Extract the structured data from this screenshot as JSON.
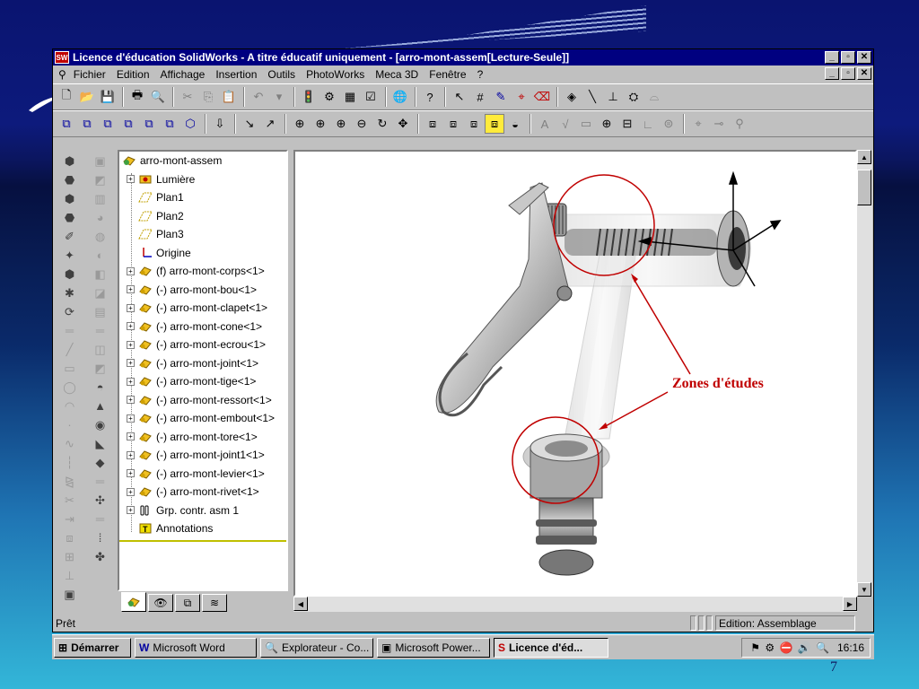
{
  "window": {
    "title": "Licence d'éducation SolidWorks - A titre éducatif uniquement - [arro-mont-assem[Lecture-Seule]]",
    "app_badge": "SW"
  },
  "menu": {
    "items": [
      {
        "label": "Fichier"
      },
      {
        "label": "Edition"
      },
      {
        "label": "Affichage"
      },
      {
        "label": "Insertion"
      },
      {
        "label": "Outils"
      },
      {
        "label": "PhotoWorks"
      },
      {
        "label": "Meca 3D"
      },
      {
        "label": "Fenêtre"
      },
      {
        "label": "?"
      }
    ]
  },
  "tree": {
    "root": "arro-mont-assem",
    "items": [
      {
        "label": "Lumière",
        "icon": "light-icon",
        "expandable": true
      },
      {
        "label": "Plan1",
        "icon": "plane-icon",
        "expandable": false
      },
      {
        "label": "Plan2",
        "icon": "plane-icon",
        "expandable": false
      },
      {
        "label": "Plan3",
        "icon": "plane-icon",
        "expandable": false
      },
      {
        "label": "Origine",
        "icon": "origin-icon",
        "expandable": false
      },
      {
        "label": "(f) arro-mont-corps<1>",
        "icon": "part-icon",
        "expandable": true
      },
      {
        "label": "(-) arro-mont-bou<1>",
        "icon": "part-icon",
        "expandable": true
      },
      {
        "label": "(-) arro-mont-clapet<1>",
        "icon": "part-icon",
        "expandable": true
      },
      {
        "label": "(-) arro-mont-cone<1>",
        "icon": "part-icon",
        "expandable": true
      },
      {
        "label": "(-) arro-mont-ecrou<1>",
        "icon": "part-icon",
        "expandable": true
      },
      {
        "label": "(-) arro-mont-joint<1>",
        "icon": "part-icon",
        "expandable": true
      },
      {
        "label": "(-) arro-mont-tige<1>",
        "icon": "part-icon",
        "expandable": true
      },
      {
        "label": "(-) arro-mont-ressort<1>",
        "icon": "part-icon",
        "expandable": true
      },
      {
        "label": "(-) arro-mont-embout<1>",
        "icon": "part-icon",
        "expandable": true
      },
      {
        "label": "(-) arro-mont-tore<1>",
        "icon": "part-icon",
        "expandable": true
      },
      {
        "label": "(-) arro-mont-joint1<1>",
        "icon": "part-icon",
        "expandable": true
      },
      {
        "label": "(-) arro-mont-levier<1>",
        "icon": "part-icon",
        "expandable": true
      },
      {
        "label": "(-) arro-mont-rivet<1>",
        "icon": "part-icon",
        "expandable": true
      },
      {
        "label": "Grp. contr. asm 1",
        "icon": "mates-icon",
        "expandable": true
      },
      {
        "label": "Annotations",
        "icon": "annotations-icon",
        "expandable": false
      }
    ]
  },
  "viewport": {
    "annotation": "Zones d'études",
    "accent_color": "#c00000"
  },
  "status": {
    "left": "Prêt",
    "mode": "Edition: Assemblage"
  },
  "taskbar": {
    "start": "Démarrer",
    "tasks": [
      {
        "label": "Microsoft Word"
      },
      {
        "label": "Explorateur - Co..."
      },
      {
        "label": "Microsoft Power..."
      },
      {
        "label": "Licence d'éd..."
      }
    ],
    "clock": "16:16"
  },
  "slide": {
    "number": "7"
  }
}
